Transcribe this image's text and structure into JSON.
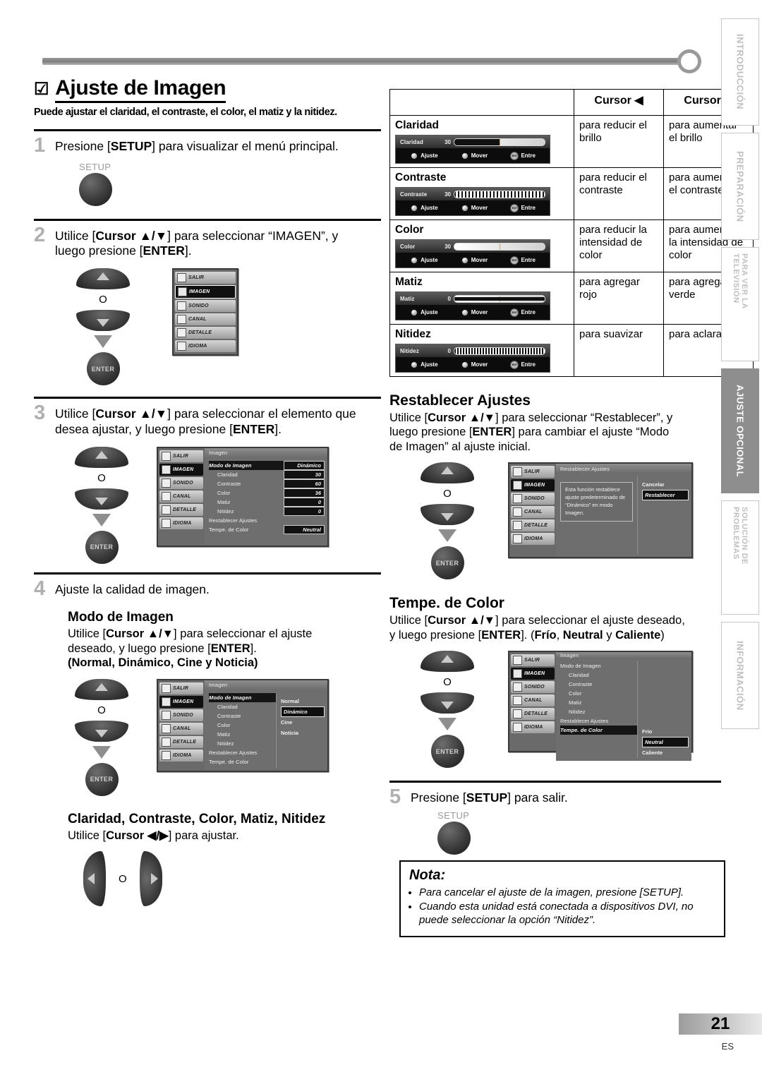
{
  "chapter": {
    "check_icon": "☑",
    "title": "Ajuste de Imagen",
    "subtitle": "Puede ajustar el claridad, el contraste, el color, el matiz y la nitidez."
  },
  "steps": {
    "s1": {
      "num": "1",
      "text_a": "Presione [",
      "bold_a": "SETUP",
      "text_b": "] para visualizar el menú principal.",
      "key_label": "SETUP"
    },
    "s2": {
      "num": "2",
      "line1_a": "Utilice [",
      "line1_b": "Cursor ▲/▼",
      "line1_c": "] para seleccionar “IMAGEN”, y",
      "line2_a": "luego presione [",
      "line2_b": "ENTER",
      "line2_c": "].",
      "or": "O",
      "enter_label": "ENTER"
    },
    "s3": {
      "num": "3",
      "line1_a": "Utilice [",
      "line1_b": "Cursor ▲/▼",
      "line1_c": "] para seleccionar el elemento que",
      "line2_a": "desea ajustar, y luego presione [",
      "line2_b": "ENTER",
      "line2_c": "].",
      "or": "O",
      "enter_label": "ENTER"
    },
    "s4": {
      "num": "4",
      "text": "Ajuste la calidad de imagen.",
      "or": "O",
      "enter_label": "ENTER"
    },
    "s5": {
      "num": "5",
      "text_a": "Presione [",
      "bold_a": "SETUP",
      "text_b": "] para salir.",
      "key_label": "SETUP"
    }
  },
  "sections": {
    "modo_imagen": {
      "heading": "Modo de Imagen",
      "line1_a": "Utilice [",
      "line1_b": "Cursor ▲/▼",
      "line1_c": "] para seleccionar el ajuste",
      "line2_a": "deseado, y luego presione [",
      "line2_b": "ENTER",
      "line2_c": "].",
      "line3": "(Normal, Dinámico, Cine y Noticia)"
    },
    "claridad_group": {
      "heading": "Claridad, Contraste, Color, Matiz, Nitidez",
      "line_a": "Utilice [",
      "line_b": "Cursor ◀/▶",
      "line_c": "] para ajustar.",
      "or": "O"
    },
    "restablecer": {
      "heading": "Restablecer Ajustes",
      "line1_a": "Utilice [",
      "line1_b": "Cursor ▲/▼",
      "line1_c": "] para seleccionar “Restablecer”, y",
      "line2_a": "luego presione [",
      "line2_b": "ENTER",
      "line2_c": "] para cambiar el ajuste “Modo",
      "line3": "de Imagen” al ajuste inicial.",
      "or": "O",
      "enter_label": "ENTER"
    },
    "tempe": {
      "heading": "Tempe. de Color",
      "line1_a": "Utilice [",
      "line1_b": "Cursor ▲/▼",
      "line1_c": "] para seleccionar el ajuste deseado,",
      "line2_a": "y luego presione [",
      "line2_b": "ENTER",
      "line2_c": "]. (",
      "line2_d": "Frío",
      "line2_e": ", ",
      "line2_f": "Neutral",
      "line2_g": " y ",
      "line2_h": "Caliente",
      "line2_i": ")",
      "or": "O",
      "enter_label": "ENTER"
    }
  },
  "table": {
    "headers": [
      "",
      "Cursor ◀",
      "Cursor ▶"
    ],
    "rows": [
      {
        "name": "Claridad",
        "slider": {
          "label": "Claridad",
          "value": "30"
        },
        "left": "para reducir el brillo",
        "right": "para aumentar el brillo"
      },
      {
        "name": "Contraste",
        "slider": {
          "label": "Contraste",
          "value": "30"
        },
        "left": "para reducir el contraste",
        "right": "para aumentar el contraste"
      },
      {
        "name": "Color",
        "slider": {
          "label": "Color",
          "value": "30"
        },
        "left": "para reducir la intensidad de color",
        "right": "para aumentar la intensidad de color"
      },
      {
        "name": "Matiz",
        "slider": {
          "label": "Matiz",
          "value": "0"
        },
        "left": "para agregar rojo",
        "right": "para agregar verde"
      },
      {
        "name": "Nitidez",
        "slider": {
          "label": "Nitidez",
          "value": "0"
        },
        "left": "para suavizar",
        "right": "para aclarar"
      }
    ],
    "slider_keys": [
      "Ajuste",
      "Mover",
      "Entre"
    ]
  },
  "osd": {
    "side_tabs": [
      "SALIR",
      "IMAGEN",
      "SONIDO",
      "CANAL",
      "DETALLE",
      "IDIOMA"
    ],
    "menu_title_imagen": "Imagen",
    "menu_title_restablecer": "Restablecer Ajustes",
    "items": [
      "Modo de Imagen",
      "Claridad",
      "Contraste",
      "Color",
      "Matiz",
      "Nitidez",
      "Restablecer Ajustes",
      "Tempe. de Color"
    ],
    "values_step3": [
      "Dinámico",
      "30",
      "60",
      "36",
      "0",
      "0",
      "",
      "Neutral"
    ],
    "modo_options": [
      "Normal",
      "Dinámico",
      "Cine",
      "Noticia"
    ],
    "modo_selected": "Dinámico",
    "reset_message": "Esta función restablece ajuste predeterminado de “Dinámico” en modo Imagen.",
    "reset_options": [
      "Cancelar",
      "Restablecer"
    ],
    "reset_selected": "Restablecer",
    "tempe_options": [
      "Frío",
      "Neutral",
      "Caliente"
    ],
    "tempe_selected": "Neutral"
  },
  "nota": {
    "title": "Nota:",
    "items": [
      "Para cancelar el ajuste de la imagen, presione [SETUP].",
      "Cuando esta unidad está conectada a dispositivos DVI, no puede seleccionar la opción “Nitidez”."
    ]
  },
  "vtabs": {
    "items": [
      "INTRODUCCIÓN",
      "PREPARACIÓN",
      "PARA VER LA TELEVISIÓN",
      "AJUSTE OPCIONAL",
      "SOLUCIÓN DE PROBLEMAS",
      "INFORMACIÓN"
    ],
    "active": "AJUSTE OPCIONAL"
  },
  "footer": {
    "page": "21",
    "lang": "ES"
  }
}
